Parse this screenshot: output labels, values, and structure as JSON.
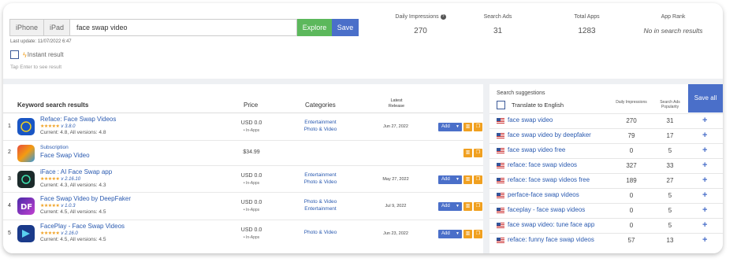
{
  "search_bar": {
    "device_tabs": [
      "iPhone",
      "iPad"
    ],
    "query": "face swap video",
    "explore_label": "Explore",
    "save_label": "Save",
    "last_update": "Last update: 11/07/2022 6:47",
    "instant_label": "Instant result",
    "tap_hint": "Tap Enter to see result"
  },
  "stats": [
    {
      "label": "Daily Impressions",
      "value": "270",
      "help_icon": "question-circle-icon"
    },
    {
      "label": "Search Ads",
      "value": "31"
    },
    {
      "label": "Total Apps",
      "value": "1283"
    },
    {
      "label": "App Rank",
      "value": "No in search results"
    }
  ],
  "results": {
    "title": "Keyword search results",
    "columns": {
      "price": "Price",
      "categories": "Categories",
      "release": "Latest Release"
    },
    "add_label": "Add",
    "rows": [
      {
        "num": "1",
        "name": "Reface: Face Swap Videos",
        "stars": "★★★★★",
        "version": "v 3.8.0",
        "current": "Current: 4.8, All versions: 4.8",
        "price": "USD 0.0",
        "inapp": "• In-Apps",
        "cat1": "Entertainment",
        "cat2": "Photo & Video",
        "release": "Jun 27, 2022",
        "icon_color": "#1a56c4"
      },
      {
        "num": "2",
        "name": "Subscription",
        "name2": "Face Swap Video",
        "price": "$34.99",
        "icon_color": "#c0392b"
      },
      {
        "num": "3",
        "name": "iFace : AI Face Swap app",
        "stars": "★★★★★",
        "version": "v 2.16.10",
        "current": "Current: 4.3, All versions: 4.3",
        "price": "USD 0.0",
        "inapp": "• In-Apps",
        "cat1": "Entertainment",
        "cat2": "Photo & Video",
        "release": "May 27, 2022",
        "icon_color": "#1b2a2a"
      },
      {
        "num": "4",
        "name": "Face Swap Video by DeepFaker",
        "stars": "★★★★★",
        "version": "v 1.0.3",
        "current": "Current: 4.5, All versions: 4.5",
        "price": "USD 0.0",
        "inapp": "• In-Apps",
        "cat1": "Photo & Video",
        "cat2": "Entertainment",
        "release": "Jul 9, 2022",
        "icon_color": "#6a3cc8"
      },
      {
        "num": "5",
        "name": "FacePlay - Face Swap Videos",
        "stars": "★★★★★",
        "version": "v 2.16.0",
        "current": "Current: 4.5, All versions: 4.5",
        "price": "USD 0.0",
        "inapp": "• In-Apps",
        "cat1": "Photo & Video",
        "release": "Jun 23, 2022",
        "icon_color": "#1a3a8a"
      }
    ]
  },
  "suggestions": {
    "title": "Search suggestions",
    "translate_label": "Translate to English",
    "col_impr": "Daily Impressions",
    "col_ads": "Search Ads Popularity",
    "save_all_label": "Save all",
    "rows": [
      {
        "kw": "face swap video",
        "impr": "270",
        "ads": "31"
      },
      {
        "kw": "face swap video by deepfaker",
        "impr": "79",
        "ads": "17"
      },
      {
        "kw": "face swap video free",
        "impr": "0",
        "ads": "5"
      },
      {
        "kw": "reface: face swap videos",
        "impr": "327",
        "ads": "33"
      },
      {
        "kw": "reface: face swap videos free",
        "impr": "189",
        "ads": "27"
      },
      {
        "kw": "perface-face swap videos",
        "impr": "0",
        "ads": "5"
      },
      {
        "kw": "faceplay - face swap videos",
        "impr": "0",
        "ads": "5"
      },
      {
        "kw": "face swap video: tune face app",
        "impr": "0",
        "ads": "5"
      },
      {
        "kw": "reface: funny face swap videos",
        "impr": "57",
        "ads": "13"
      }
    ]
  }
}
